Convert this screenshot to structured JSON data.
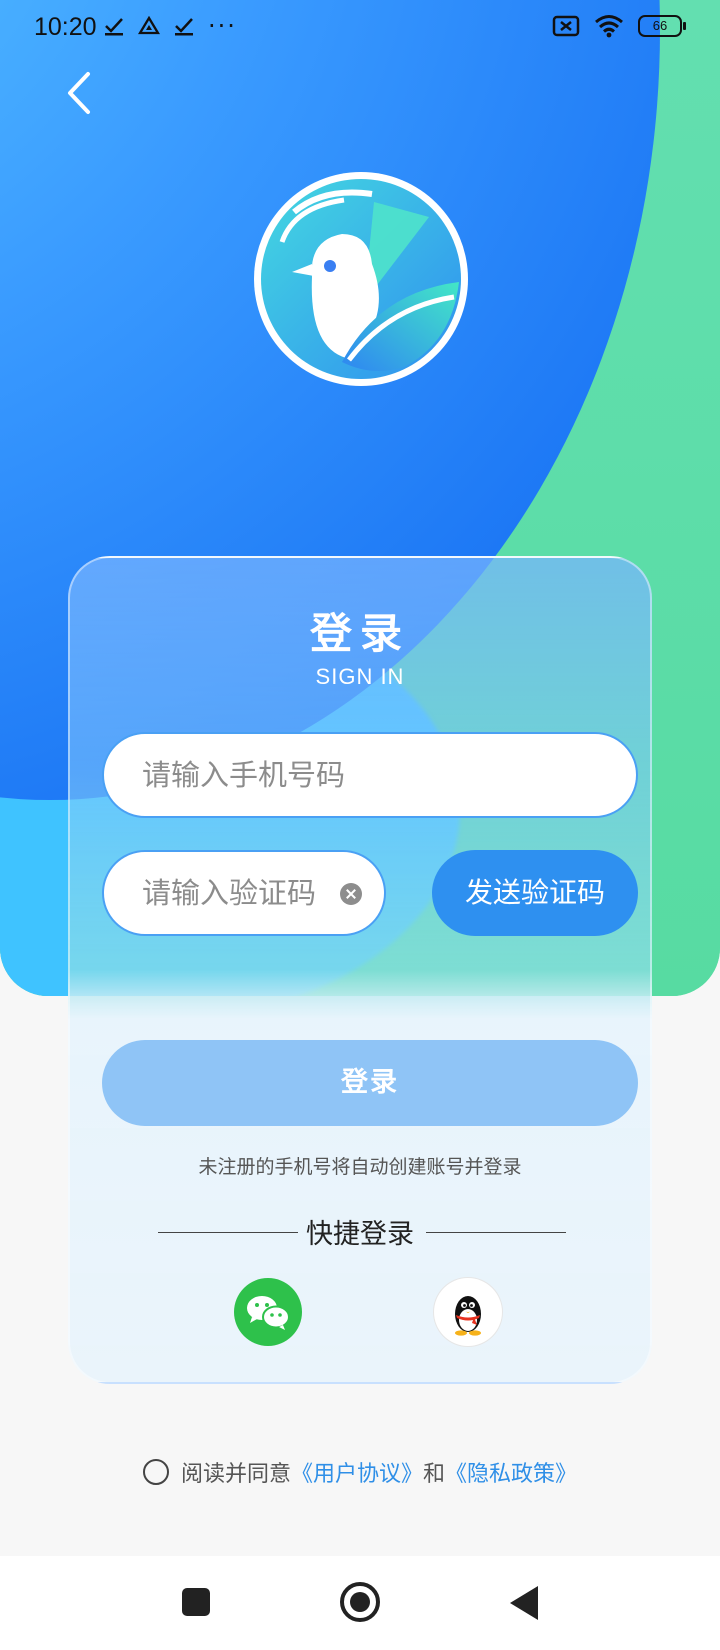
{
  "status_bar": {
    "time": "10:20",
    "left_icons": [
      "check-download-icon",
      "drive-icon",
      "check-download-icon",
      "more-dots-icon"
    ],
    "more": "···",
    "battery": "66"
  },
  "nav": {
    "back_icon": "chevron-left-icon"
  },
  "card": {
    "title": "登录",
    "subtitle": "SIGN IN",
    "phone_placeholder": "请输入手机号码",
    "code_placeholder": "请输入验证码",
    "send_code_label": "发送验证码",
    "login_label": "登录",
    "hint": "未注册的手机号将自动创建账号并登录",
    "quick_login_label": "快捷登录"
  },
  "agreement": {
    "prefix": "阅读并同意",
    "user_agreement": "《用户协议》",
    "and": "和",
    "privacy_policy": "《隐私政策》"
  },
  "colors": {
    "primary_blue": "#2e90f0",
    "link_blue": "#2f8fe7",
    "wechat_green": "#2ec14b",
    "hero_green": "#57dba2"
  }
}
